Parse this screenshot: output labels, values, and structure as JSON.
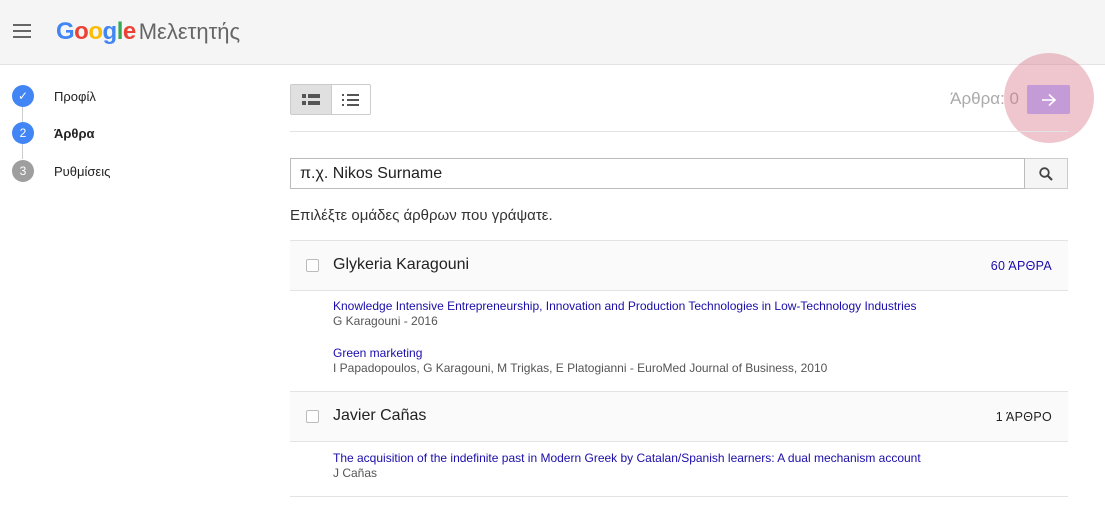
{
  "header": {
    "logo_google": "Google",
    "logo_product": "Μελετητής",
    "google_colors": [
      "#4285F4",
      "#EA4335",
      "#FBBC05",
      "#4285F4",
      "#34A853",
      "#EA4335"
    ]
  },
  "steps": [
    {
      "number": "✓",
      "label": "Προφίλ",
      "state": "done",
      "color": "#4285F4"
    },
    {
      "number": "2",
      "label": "Άρθρα",
      "state": "active",
      "color": "#4285F4"
    },
    {
      "number": "3",
      "label": "Ρυθμίσεις",
      "state": "pending",
      "color": "#9e9e9e"
    }
  ],
  "toolbar": {
    "count_label": "Άρθρα: 0",
    "next_icon": "arrow-right-icon"
  },
  "search": {
    "value": "π.χ. Nikos Surname",
    "placeholder": "π.χ. Nikos Surname",
    "icon": "search-icon"
  },
  "instruction": "Επιλέξτε ομάδες άρθρων που γράψατε.",
  "groups": [
    {
      "name": "Glykeria Karagouni",
      "count": "60 ΆΡΘΡΑ",
      "count_color": "#1a0dab",
      "articles": [
        {
          "title": "Knowledge Intensive Entrepreneurship, Innovation and Production Technologies in Low-Technology Industries",
          "meta": "G Karagouni - 2016"
        },
        {
          "title": "Green marketing",
          "meta": "I Papadopoulos, G Karagouni, M Trigkas, E Platogianni - EuroMed Journal of Business, 2010"
        }
      ]
    },
    {
      "name": "Javier Cañas",
      "count": "1 ΆΡΘΡΟ",
      "count_color": "#222222",
      "articles": [
        {
          "title": "The acquisition of the indefinite past in Modern Greek by Catalan/Spanish learners: A dual mechanism account",
          "meta": "J Cañas"
        }
      ]
    }
  ]
}
